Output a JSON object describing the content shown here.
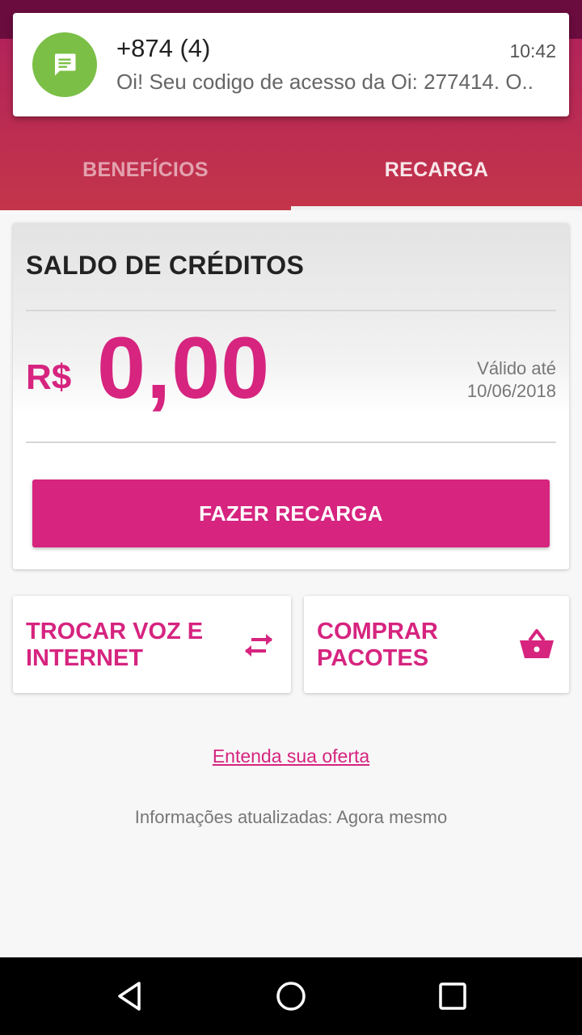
{
  "notification": {
    "title": "+874 (4)",
    "time": "10:42",
    "body": "Oi! Seu codigo de acesso da Oi: 277414. O..",
    "icon": "message-icon"
  },
  "tabs": [
    {
      "label": "BENEFÍCIOS",
      "active": false
    },
    {
      "label": "RECARGA",
      "active": true
    }
  ],
  "saldo": {
    "title": "SALDO DE CRÉDITOS",
    "currency": "R$",
    "amount": "0,00",
    "valid_label": "Válido até",
    "valid_date": "10/06/2018",
    "button_label": "FAZER RECARGA"
  },
  "actions": {
    "trocar_line1": "TROCAR VOZ E",
    "trocar_line2": "INTERNET",
    "trocar_icon": "swap-arrows-icon",
    "comprar_line1": "COMPRAR",
    "comprar_line2": "PACOTES",
    "comprar_icon": "basket-icon"
  },
  "footer": {
    "link": "Entenda sua oferta",
    "updated": "Informações atualizadas: Agora mesmo"
  },
  "colors": {
    "accent": "#d6247f",
    "header_top": "#b3235a",
    "header_bottom": "#c4354a",
    "notification_avatar": "#7cbf47"
  }
}
